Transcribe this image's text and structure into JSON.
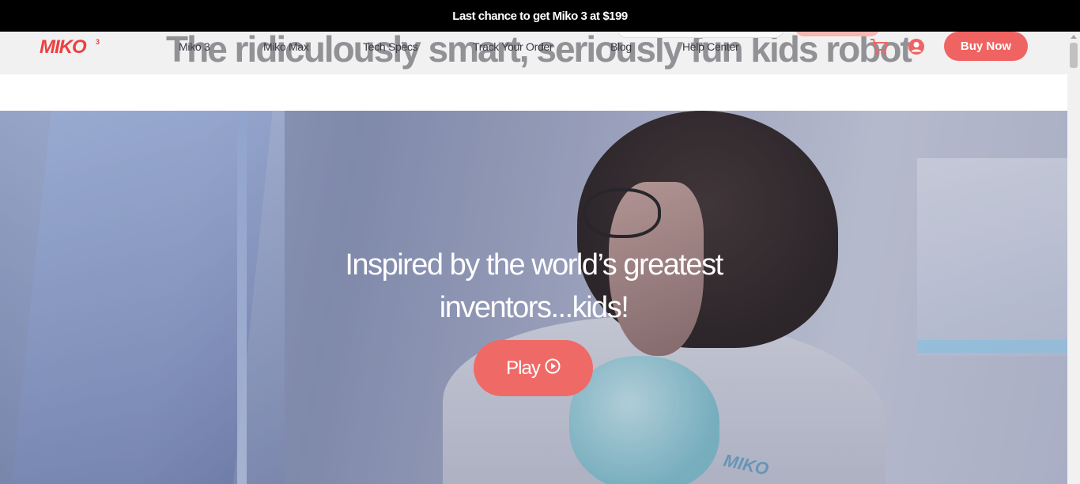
{
  "promo": {
    "text": "Last chance to get Miko 3 at",
    "price": "$199"
  },
  "header": {
    "logo_text": "MIKO",
    "logo_sup": "3",
    "ghost_headline": "The ridiculously smart, seriously fun kids robot",
    "nav": [
      "Miko 3",
      "Miko Max",
      "Tech Specs",
      "Track Your Order",
      "Blog",
      "Help Center"
    ],
    "buy_label": "Buy Now",
    "cart_icon": "cart-icon",
    "account_icon": "user-circle-icon"
  },
  "hero": {
    "title_line1": "Inspired by the world’s greatest",
    "title_line2": "inventors...kids!",
    "play_label": "Play",
    "play_icon": "play-circle-icon",
    "robot_brand": "MIKO"
  },
  "colors": {
    "accent": "#ef6462",
    "promo_bg": "#000000",
    "header_bg": "#f1f1f2"
  }
}
